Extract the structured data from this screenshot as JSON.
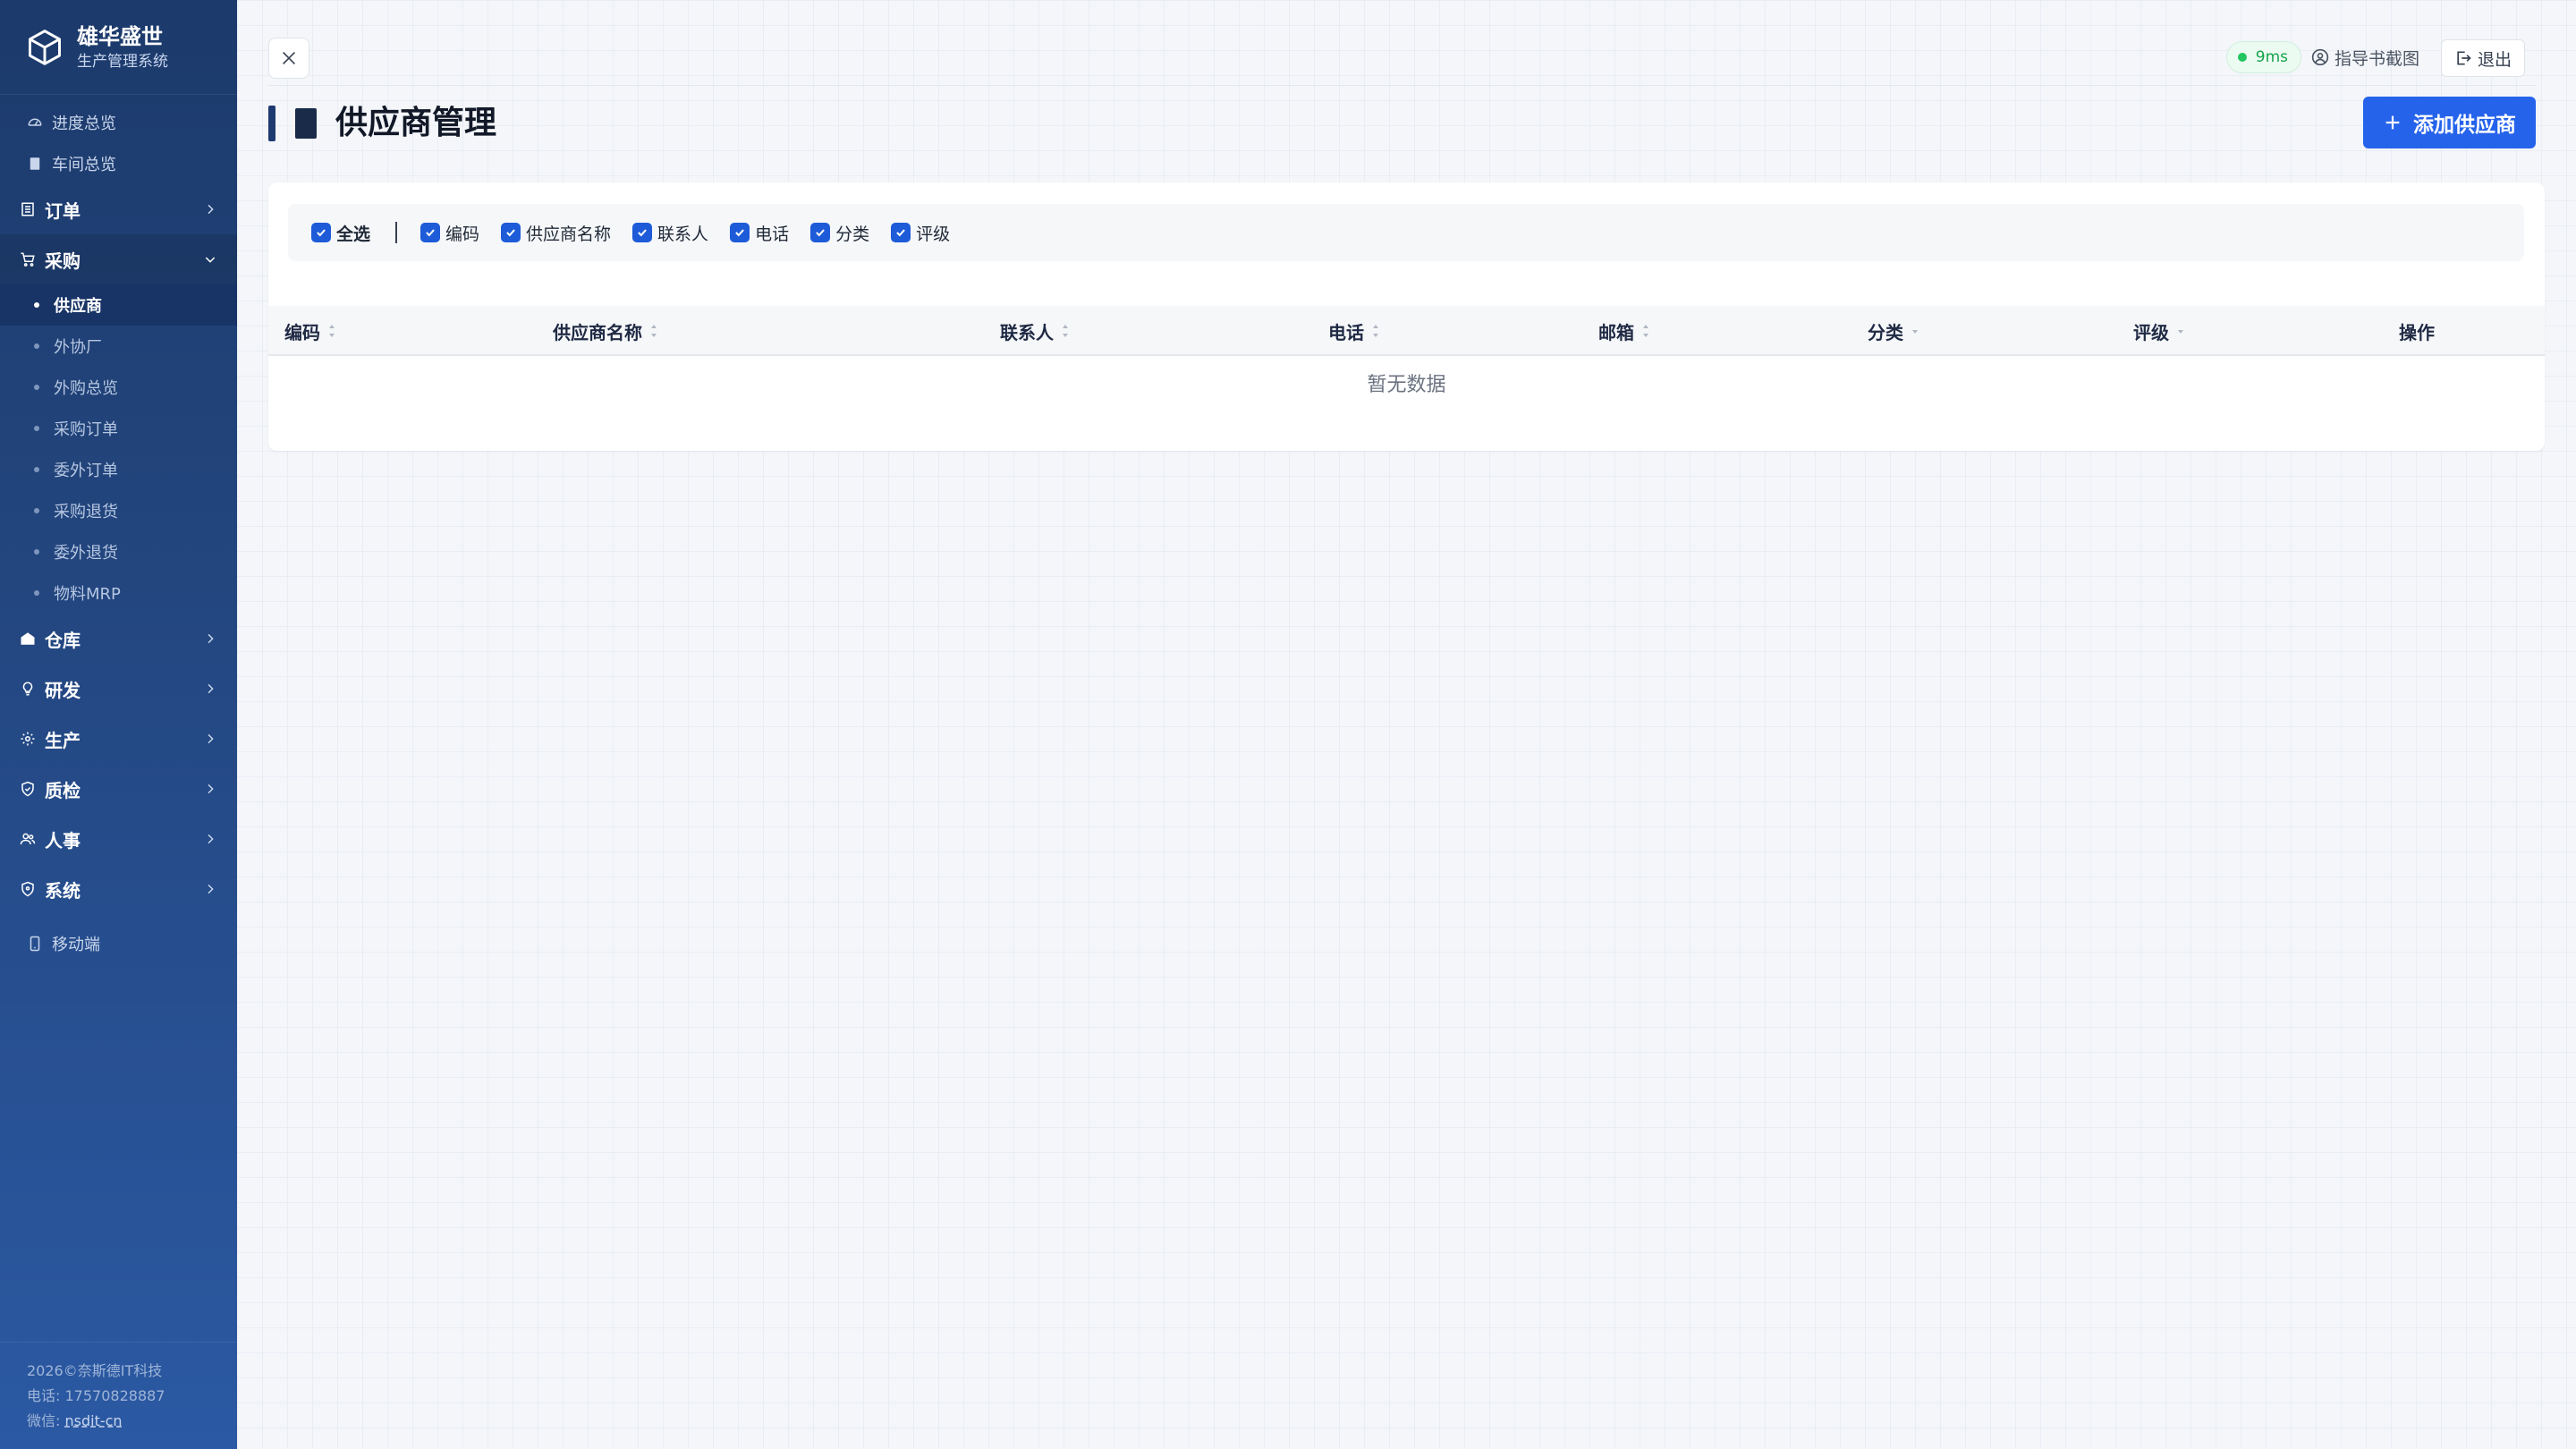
{
  "brand": {
    "name": "雄华盛世",
    "subtitle": "生产管理系统"
  },
  "sidebar": {
    "quick": [
      {
        "label": "进度总览",
        "icon": "dashboard-icon"
      },
      {
        "label": "车间总览",
        "icon": "document-icon"
      }
    ],
    "groups": [
      {
        "label": "订单",
        "icon": "orders-icon",
        "expanded": false
      },
      {
        "label": "采购",
        "icon": "cart-icon",
        "expanded": true,
        "children": [
          "供应商",
          "外协厂",
          "外购总览",
          "采购订单",
          "委外订单",
          "采购退货",
          "委外退货",
          "物料MRP"
        ],
        "active": "供应商"
      },
      {
        "label": "仓库",
        "icon": "warehouse-icon",
        "expanded": false
      },
      {
        "label": "研发",
        "icon": "lightbulb-icon",
        "expanded": false
      },
      {
        "label": "生产",
        "icon": "gear-icon",
        "expanded": false
      },
      {
        "label": "质检",
        "icon": "shield-check-icon",
        "expanded": false
      },
      {
        "label": "人事",
        "icon": "users-icon",
        "expanded": false
      },
      {
        "label": "系统",
        "icon": "shield-icon",
        "expanded": false
      }
    ],
    "mobile": {
      "label": "移动端",
      "icon": "mobile-icon"
    },
    "footer": {
      "copyright": "2026©奈斯德IT科技",
      "phone_label": "电话:",
      "phone": "17570828887",
      "wechat_label": "微信:",
      "wechat": "nsdit-cn"
    }
  },
  "topbar": {
    "latency": "9ms",
    "guide": "指导书截图",
    "logout": "退出"
  },
  "page": {
    "title": "供应商管理",
    "add_button": "添加供应商"
  },
  "filters": {
    "all_label": "全选",
    "items": [
      "编码",
      "供应商名称",
      "联系人",
      "电话",
      "分类",
      "评级"
    ]
  },
  "table": {
    "columns": [
      "编码",
      "供应商名称",
      "联系人",
      "电话",
      "邮箱",
      "分类",
      "评级",
      "操作"
    ],
    "empty_text": "暂无数据"
  },
  "colors": {
    "primary": "#2563eb",
    "sidebar": "#23467f",
    "success": "#22c55e"
  }
}
